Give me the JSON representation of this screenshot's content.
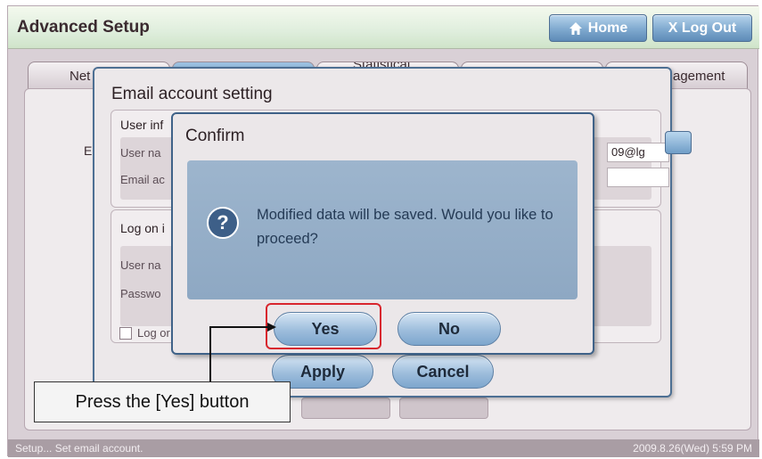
{
  "header": {
    "title": "Advanced Setup",
    "home_label": "Home",
    "logout_label": "X Log Out"
  },
  "tabs": [
    {
      "label": "Net"
    },
    {
      "label": ""
    },
    {
      "label": "Statistical"
    },
    {
      "label": ""
    },
    {
      "label": "agement"
    }
  ],
  "email_dialog": {
    "title": "Email account setting",
    "user_info_label": "User inf",
    "user_name_label": "User na",
    "email_addr_label": "Email ac",
    "logon_info_label": "Log on i",
    "logon_user_label": "User na",
    "password_label": "Passwo",
    "email_value": "09@lg",
    "side_letter": "E",
    "checkbox_label": "Log or",
    "apply_label": "Apply",
    "cancel_label": "Cancel"
  },
  "confirm_dialog": {
    "title": "Confirm",
    "message": "Modified data will be saved.  Would you like to proceed?",
    "yes_label": "Yes",
    "no_label": "No",
    "icon": "question-icon"
  },
  "annotation": {
    "callout_text": "Press the [Yes] button",
    "highlight_color": "#d8262e"
  },
  "status": {
    "left": "Setup... Set email account.",
    "right": "2009.8.26(Wed)  5:59 PM"
  }
}
